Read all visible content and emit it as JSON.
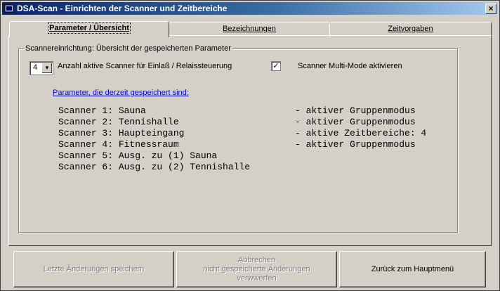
{
  "window": {
    "title": "DSA-Scan - Einrichten der Scanner und Zeitbereiche",
    "close_glyph": "×"
  },
  "tabs": [
    {
      "label": "Parameter / Übersicht",
      "active": true
    },
    {
      "label": "Bezeichnungen",
      "active": false
    },
    {
      "label": "Zeitvorgaben",
      "active": false
    }
  ],
  "group": {
    "label": "Scannereinrichtung: Übersicht der gespeicherten Parameter"
  },
  "scanner_count": {
    "value": "4",
    "label": "Anzahl aktive Scanner für Einlaß / Relaissteuerung"
  },
  "multimode": {
    "checked": "✓",
    "label": "Scanner Multi-Mode aktivieren"
  },
  "saved_link": "Parameter, die derzeit gespeichert sind:",
  "scanners": [
    {
      "name": "Scanner 1: Sauna",
      "mode": "- aktiver Gruppenmodus"
    },
    {
      "name": "Scanner 2: Tennishalle",
      "mode": "- aktiver Gruppenmodus"
    },
    {
      "name": "Scanner 3: Haupteingang",
      "mode": "- aktive Zeitbereiche: 4"
    },
    {
      "name": "Scanner 4: Fitnessraum",
      "mode": "- aktiver Gruppenmodus"
    },
    {
      "name": "Scanner 5: Ausg. zu (1) Sauna",
      "mode": ""
    },
    {
      "name": "Scanner 6: Ausg. zu (2) Tennishalle",
      "mode": ""
    }
  ],
  "buttons": {
    "save": "Letzte Änderungen speichern",
    "cancel": "Abbrechen\nnicht gespeicherte Änderungen\nverwwerfen",
    "back": "Zurück zum Hauptmenü"
  }
}
